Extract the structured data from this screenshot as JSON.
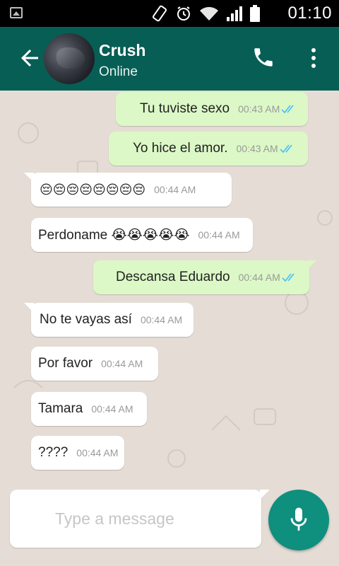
{
  "status_bar": {
    "time": "01:10",
    "icons": [
      "image-icon",
      "phone-rotate-icon",
      "alarm-icon",
      "wifi-icon",
      "signal-icon",
      "battery-icon"
    ]
  },
  "header": {
    "contact_name": "Crush",
    "contact_status": "Online",
    "icons": [
      "back-arrow-icon",
      "phone-icon",
      "more-vert-icon"
    ],
    "colors": {
      "bar": "#075e54"
    }
  },
  "messages": [
    {
      "direction": "out",
      "text": "Tu tuviste sexo",
      "time": "00:43 AM",
      "read": true
    },
    {
      "direction": "out",
      "text": "Yo hice el amor.",
      "time": "00:43 AM",
      "read": true
    },
    {
      "direction": "in",
      "text": "😔😔😔😔😔😔😔😔",
      "time": "00:44 AM"
    },
    {
      "direction": "in",
      "text": "Perdoname 😭😭😭😭😭",
      "time": "00:44 AM"
    },
    {
      "direction": "out",
      "text": "Descansa Eduardo",
      "time": "00:44 AM",
      "read": true
    },
    {
      "direction": "in",
      "text": "No te vayas así",
      "time": "00:44 AM"
    },
    {
      "direction": "in",
      "text": "Por favor",
      "time": "00:44 AM"
    },
    {
      "direction": "in",
      "text": "Tamara",
      "time": "00:44 AM"
    },
    {
      "direction": "in",
      "text": "????",
      "time": "00:44 AM"
    }
  ],
  "composer": {
    "placeholder": "Type a message",
    "value": "",
    "mic_icon": "microphone-icon",
    "colors": {
      "mic": "#0f8f7e",
      "outgoing": "#dcf8c6",
      "read_ticks": "#4fc3f7"
    }
  }
}
